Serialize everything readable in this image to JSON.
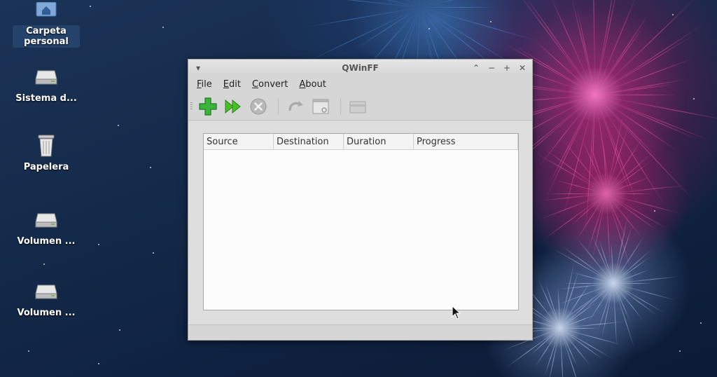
{
  "desktop": {
    "icons": [
      {
        "label": "Carpeta personal",
        "icon": "home-folder-icon"
      },
      {
        "label": "Sistema d...",
        "icon": "drive-icon"
      },
      {
        "label": "Papelera",
        "icon": "trash-icon"
      },
      {
        "label": "Volumen ...",
        "icon": "drive-icon"
      },
      {
        "label": "Volumen ...",
        "icon": "drive-icon"
      }
    ]
  },
  "window": {
    "title": "QWinFF",
    "menu": [
      {
        "mnemonic": "F",
        "rest": "ile"
      },
      {
        "mnemonic": "E",
        "rest": "dit"
      },
      {
        "mnemonic": "C",
        "rest": "onvert"
      },
      {
        "mnemonic": "A",
        "rest": "bout"
      }
    ],
    "toolbar": {
      "icons": [
        "add-file-icon",
        "start-conversion-icon",
        "stop-icon",
        "retry-icon",
        "preview-icon",
        "open-folder-icon"
      ]
    },
    "table": {
      "columns": [
        "Source",
        "Destination",
        "Duration",
        "Progress"
      ]
    }
  },
  "colors": {
    "window_bg": "#d6d6d6",
    "add_green": "#3cb33c",
    "desktop_bg": "#142a4a"
  }
}
